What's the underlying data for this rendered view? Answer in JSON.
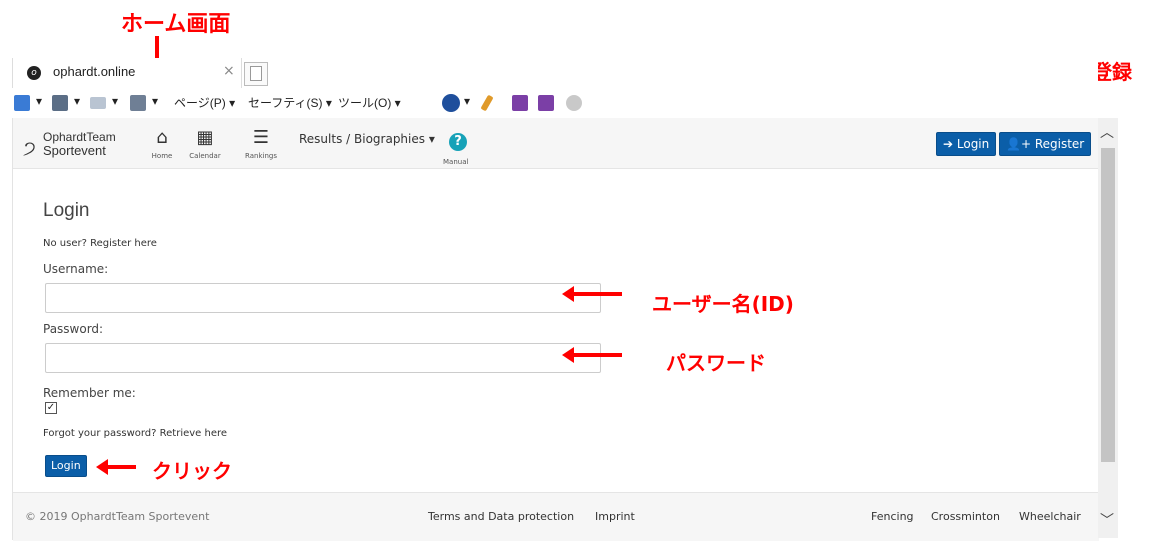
{
  "browser": {
    "tab_title": "ophardt.online",
    "tab_close": "×",
    "commands": {
      "page": "ページ(P) ▾",
      "safety": "セーフティ(S) ▾",
      "tools": "ツール(O) ▾"
    }
  },
  "site": {
    "logo_line1": "OphardtTeam",
    "logo_line2": "Sportevent",
    "nav": [
      {
        "label": "Home",
        "icon": "home-icon"
      },
      {
        "label": "Calendar",
        "icon": "calendar-icon"
      },
      {
        "label": "Rankings",
        "icon": "rankings-icon"
      }
    ],
    "results_menu": "Results / Biographies ▾",
    "manual_label": "Manual",
    "manual_icon": "?",
    "login_button": "Login",
    "register_button": "Register"
  },
  "login_form": {
    "heading": "Login",
    "no_user": "No user? Register here",
    "username_label": "Username:",
    "username_value": "",
    "password_label": "Password:",
    "password_value": "",
    "remember_label": "Remember me:",
    "remember_checked": true,
    "forgot": "Forgot your password? Retrieve here",
    "submit": "Login"
  },
  "footer": {
    "copyright": "© 2019 OphardtTeam Sportevent",
    "links": [
      "Terms and Data protection",
      "Imprint"
    ],
    "sports": [
      "Fencing",
      "Crossminton",
      "Wheelchair"
    ]
  },
  "annotations": {
    "home": "ホーム画面",
    "register": "新規ID登録",
    "username": "ユーザー名(ID)",
    "password": "パスワード",
    "click": "クリック"
  },
  "colors": {
    "annotation": "#ff0000",
    "primary_button": "#0b5ea8",
    "manual_icon": "#17a2b8"
  }
}
